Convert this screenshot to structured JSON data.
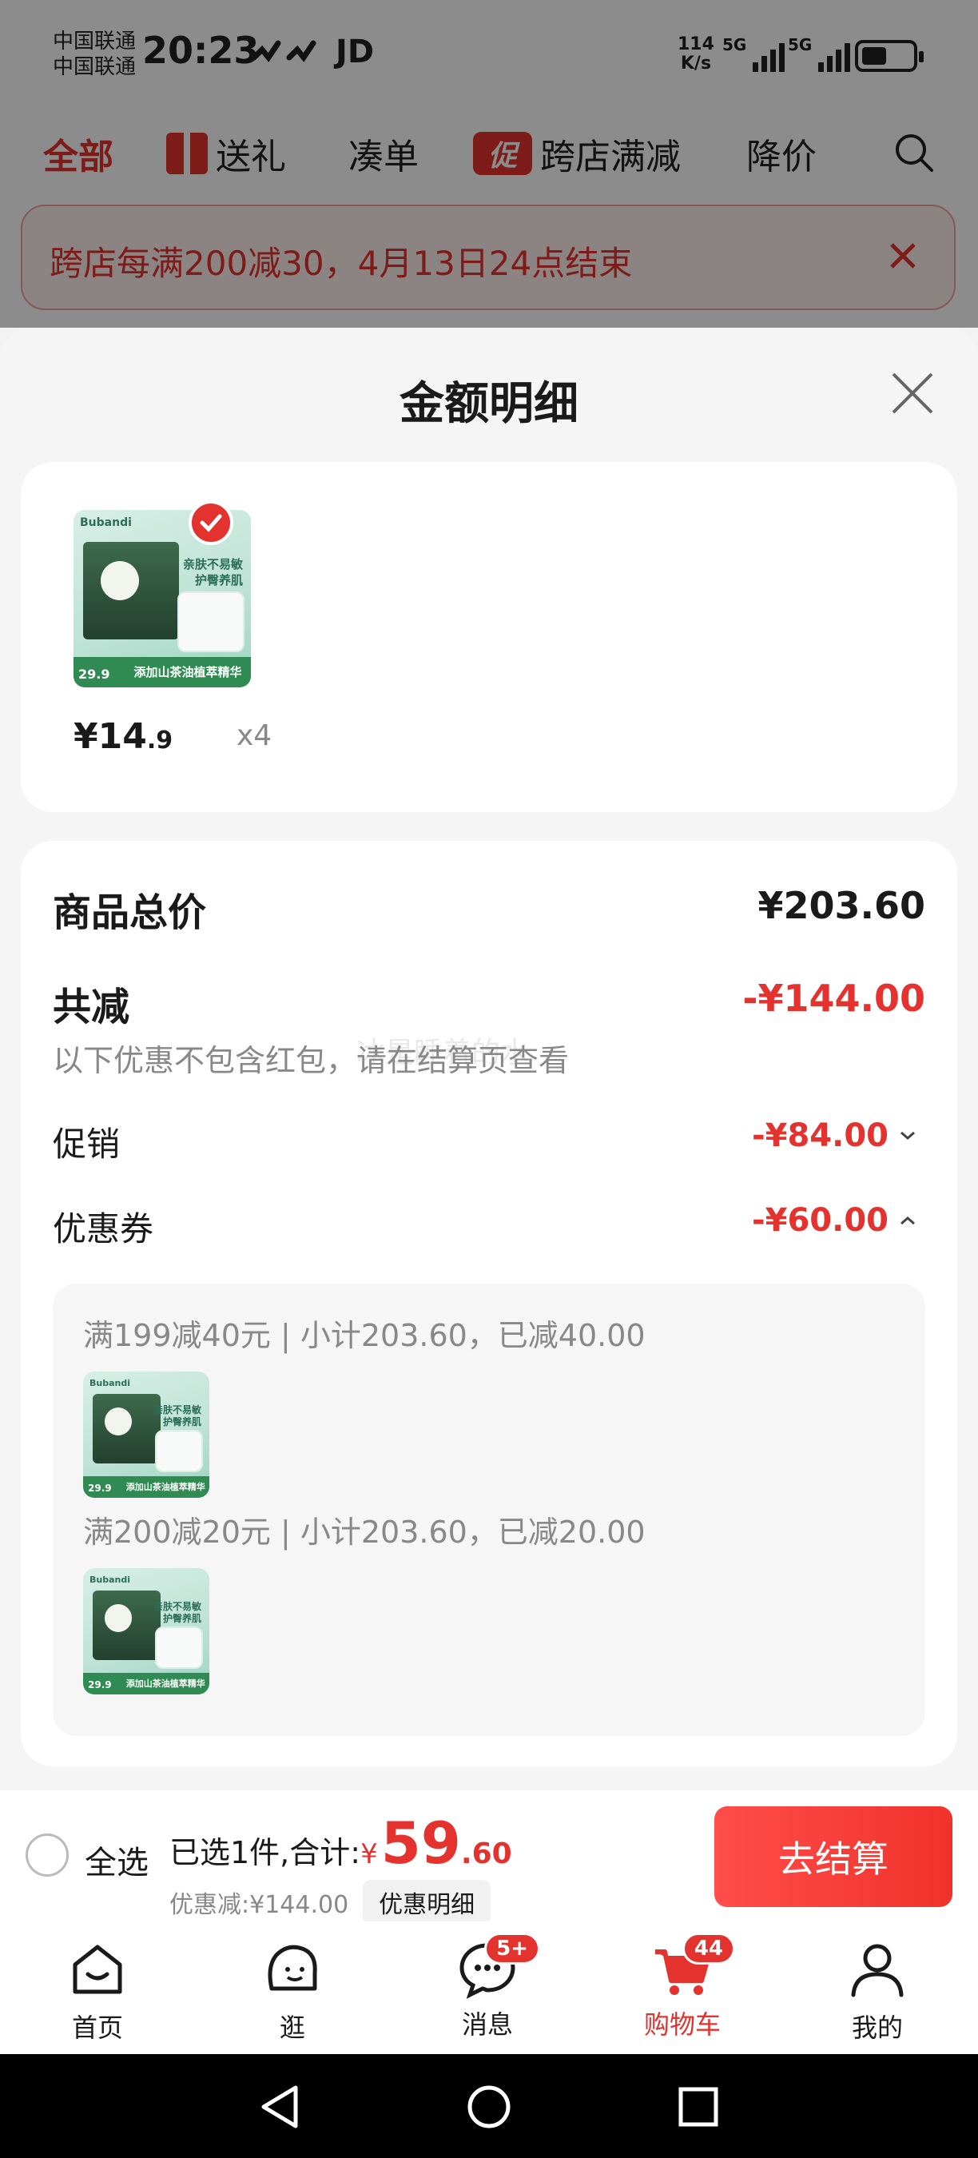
{
  "status_bar": {
    "carrier_1": "中国联通",
    "carrier_2": "中国联通",
    "time": "20:23",
    "extra": "JD",
    "net_speed_value": "114",
    "net_speed_unit": "K/s",
    "signal_1": "5G",
    "signal_2": "5G"
  },
  "top_tabs": {
    "all": "全部",
    "gift": "送礼",
    "bundle": "凑单",
    "promo_badge": "促",
    "cross_store": "跨店满减",
    "price_drop": "降价"
  },
  "promo_banner": {
    "text": "跨店每满200减30，4月13日24点结束"
  },
  "sheet": {
    "title": "金额明细",
    "product": {
      "price_int": "¥14",
      "price_dec": ".9",
      "quantity": "x4",
      "thumb_brand": "Bubandi",
      "thumb_tag": "亲肤不易敏",
      "thumb_tag2": "护臀养肌",
      "thumb_price": "29.9",
      "thumb_strip": "添加山茶油植萃精华"
    },
    "summary": {
      "total_label": "商品总价",
      "total_value": "¥203.60",
      "discount_label": "共减",
      "discount_value": "-¥144.00",
      "discount_note": "以下优惠不包含红包，请在结算页查看",
      "watermark": "冰是睡着的水",
      "promo_label": "促销",
      "promo_value": "-¥84.00",
      "coupon_label": "优惠券",
      "coupon_value": "-¥60.00",
      "coupon_lines": [
        "满199减40元 | 小计203.60，已减40.00",
        "满200减20元 | 小计203.60，已减20.00"
      ]
    }
  },
  "bottom_bar": {
    "select_all": "全选",
    "selected_text": "已选1件,合计:",
    "total_currency": "¥",
    "total_int": "59",
    "total_dec": ".60",
    "discount_text": "优惠减:¥144.00",
    "detail_chip": "优惠明细",
    "checkout": "去结算"
  },
  "tabbar": {
    "home": "首页",
    "browse": "逛",
    "messages": "消息",
    "messages_badge": "5+",
    "cart": "购物车",
    "cart_badge": "44",
    "me": "我的"
  },
  "colors": {
    "accent": "#e4332e",
    "background": "#f5f5f5"
  }
}
